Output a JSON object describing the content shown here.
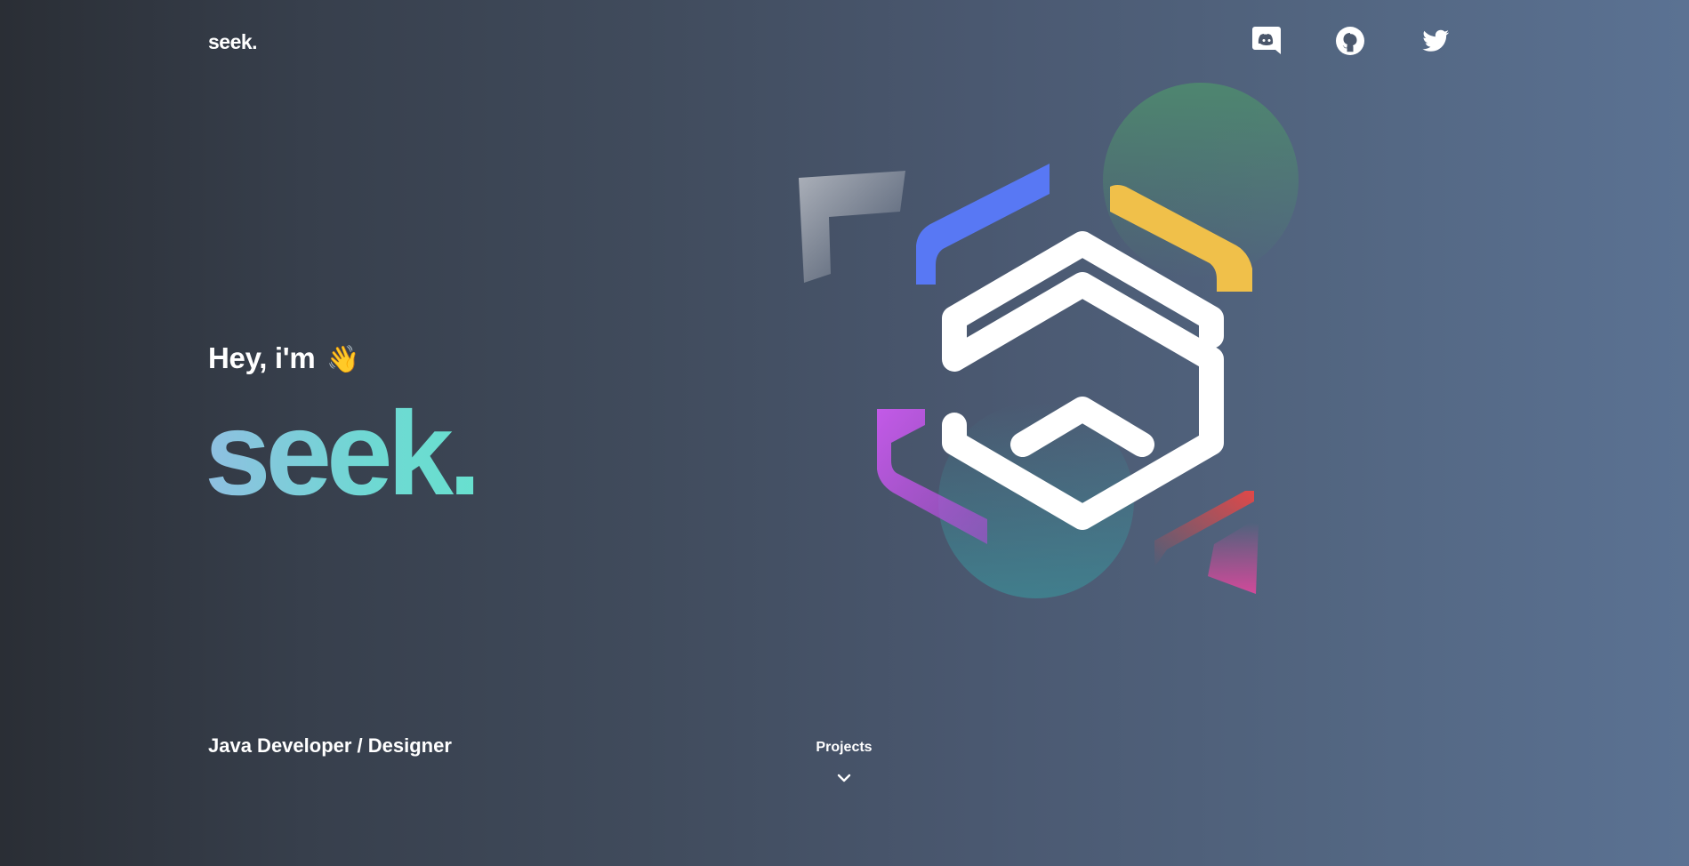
{
  "header": {
    "brand": "seek.",
    "social": [
      {
        "name": "discord",
        "icon": "discord-icon"
      },
      {
        "name": "github",
        "icon": "github-icon"
      },
      {
        "name": "twitter",
        "icon": "twitter-icon"
      }
    ]
  },
  "hero": {
    "greeting": "Hey, i'm",
    "greeting_emoji": "👋",
    "name": "seek.",
    "tagline": "Java Developer / Designer"
  },
  "nav": {
    "projects_label": "Projects",
    "scroll_icon": "chevron-down-icon"
  },
  "colors": {
    "background_start": "#2a2e35",
    "background_end": "#5b7293",
    "name_gradient_start": "#8fbfe1",
    "name_gradient_end": "#68e0cf",
    "accent_blue": "#5b7cf7",
    "accent_yellow": "#f0c04a",
    "accent_purple": "#c05ae6",
    "accent_red": "#e04848",
    "accent_green": "#4e8a6e"
  }
}
